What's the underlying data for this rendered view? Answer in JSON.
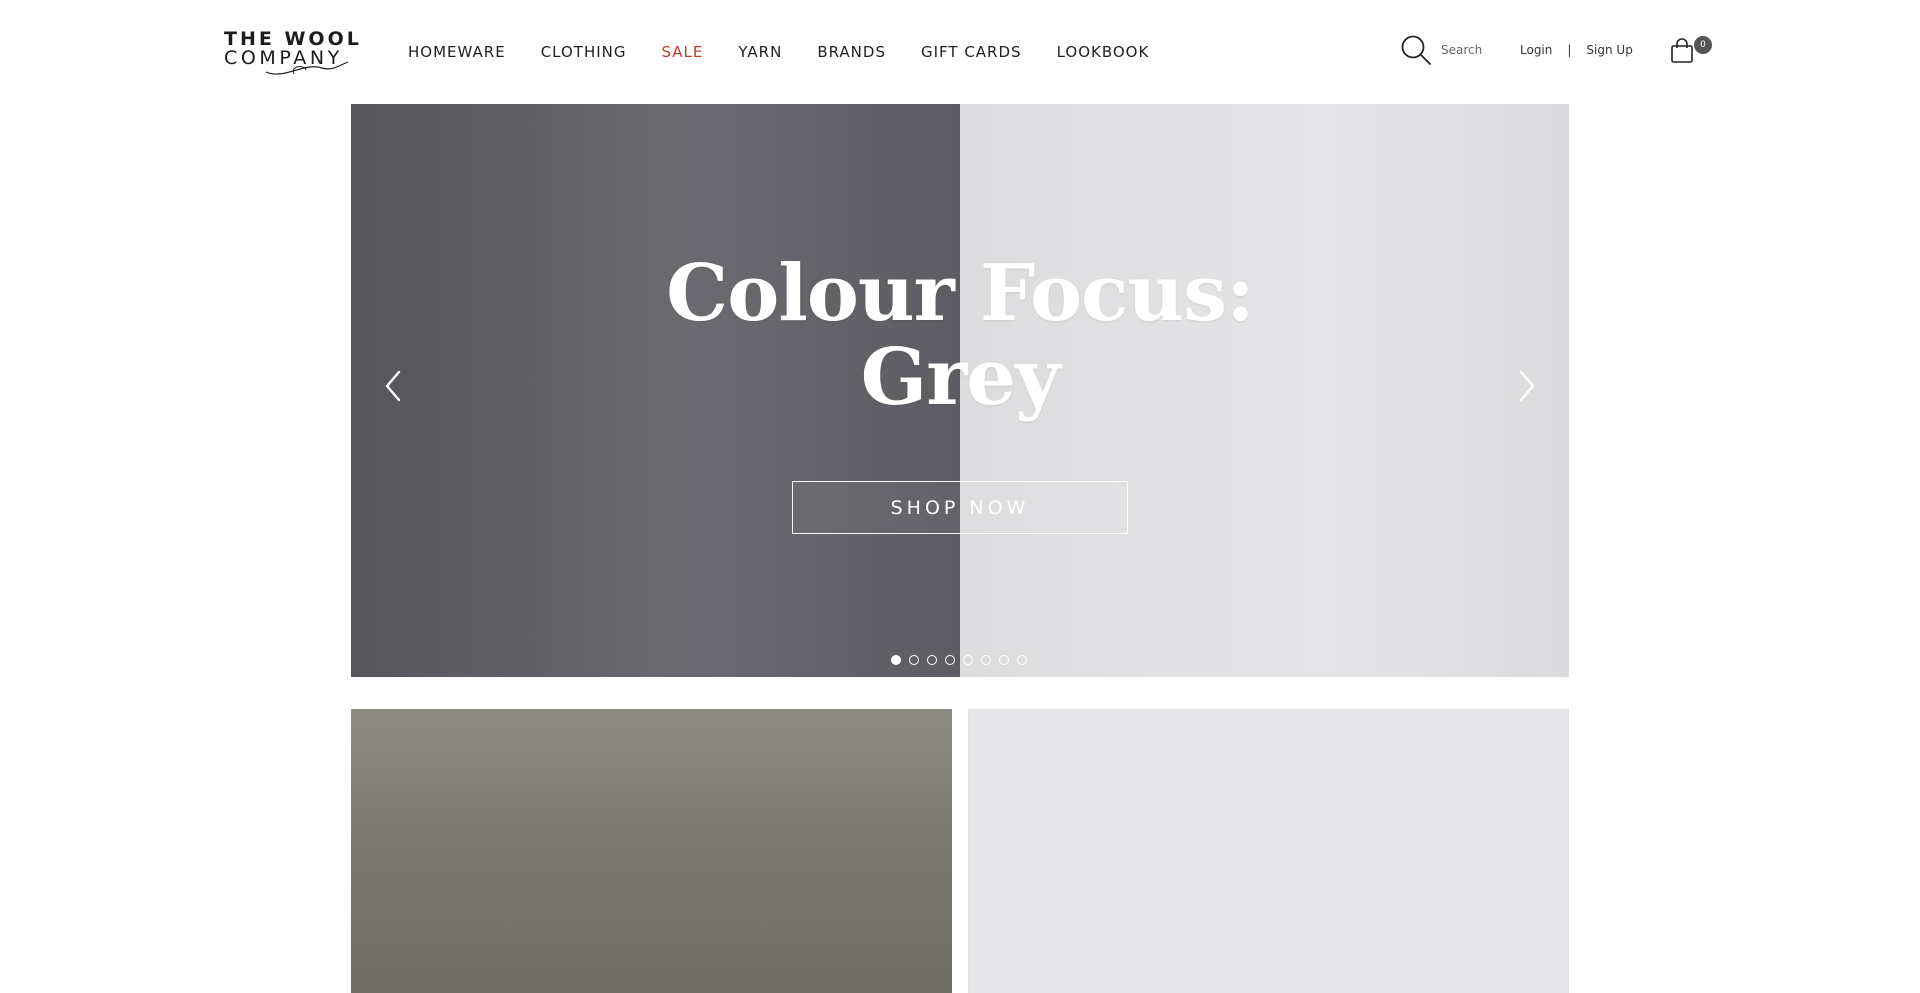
{
  "brand": {
    "line1": "THE WOOL",
    "line2": "COMPANY"
  },
  "nav": [
    {
      "label": "HOMEWARE"
    },
    {
      "label": "CLOTHING"
    },
    {
      "label": "SALE"
    },
    {
      "label": "YARN"
    },
    {
      "label": "BRANDS"
    },
    {
      "label": "GIFT CARDS"
    },
    {
      "label": "LOOKBOOK"
    }
  ],
  "search": {
    "label": "Search",
    "icon": "search-icon"
  },
  "auth": {
    "login": "Login",
    "separator": "|",
    "signup": "Sign Up"
  },
  "cart": {
    "count": "0",
    "icon": "shopping-bag-icon"
  },
  "hero": {
    "title_line1": "Colour Focus:",
    "title_line2": "Grey",
    "cta": "SHOP NOW",
    "slide_count": 8,
    "active_slide": 1,
    "prev_icon": "chevron-left-icon",
    "next_icon": "chevron-right-icon"
  },
  "colors": {
    "accent_sale": "#c0392b",
    "text": "#1f1f1f",
    "hero_text": "#ffffff"
  }
}
